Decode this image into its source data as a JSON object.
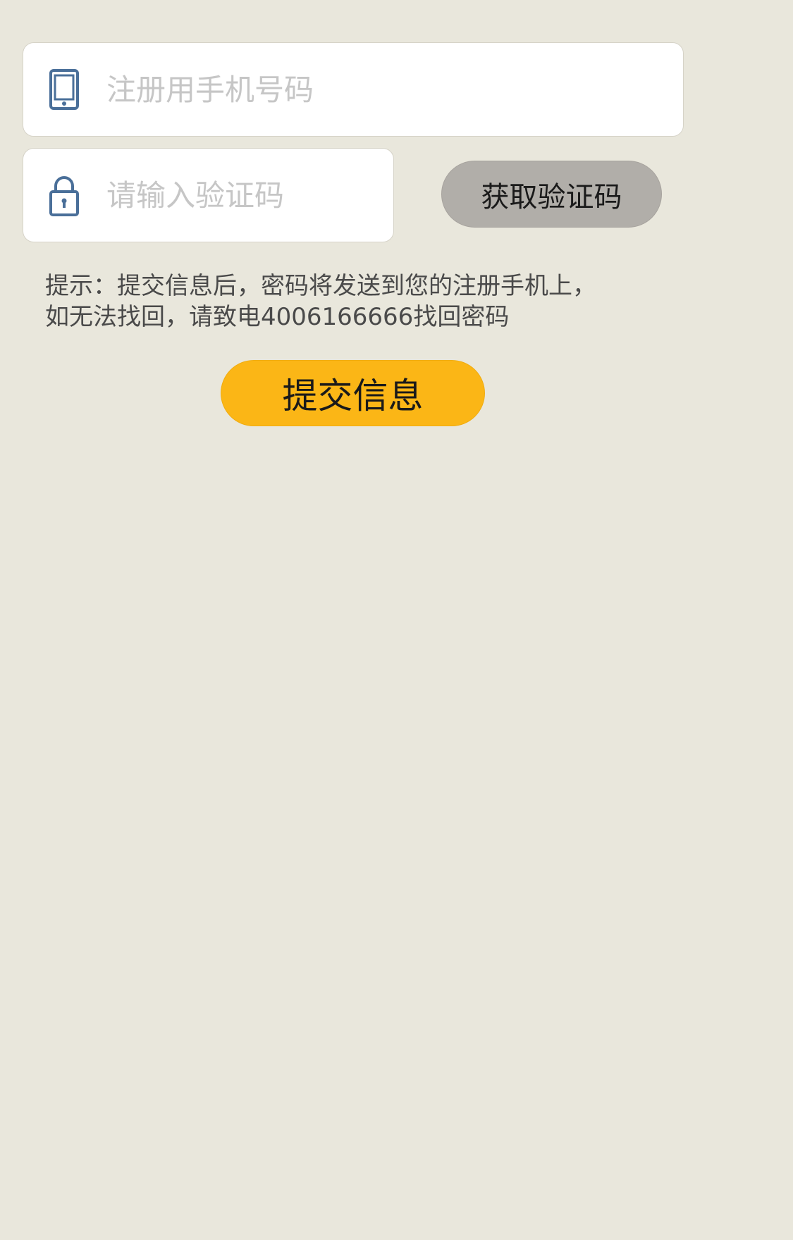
{
  "form": {
    "phone": {
      "placeholder": "注册用手机号码",
      "value": "",
      "icon": "mobile-phone-icon"
    },
    "code": {
      "placeholder": "请输入验证码",
      "value": "",
      "icon": "padlock-icon"
    },
    "get_code_label": "获取验证码",
    "hint_line1": "提示：提交信息后，密码将发送到您的注册手机上，",
    "hint_line2": "如无法找回，请致电4006166666找回密码",
    "submit_label": "提交信息"
  },
  "colors": {
    "background": "#e9e7dc",
    "icon": "#4a6f99",
    "get_code_button": "#b1aea9",
    "submit_button": "#fbb616"
  }
}
